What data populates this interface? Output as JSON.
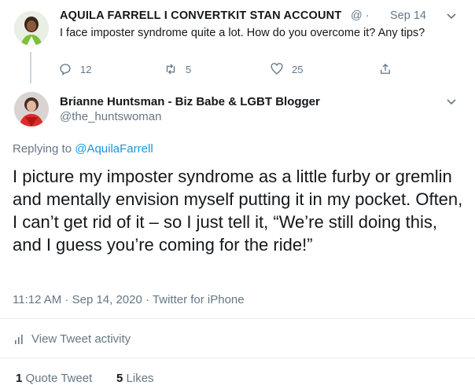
{
  "parent": {
    "name": "AQUILA FARRELL I CONVERTKIT STAN ACCOUNT",
    "handle_sep": "@ ·",
    "date": "Sep 14",
    "text": "I face imposter syndrome quite a lot. How do you overcome it? Any tips?",
    "replies": "12",
    "retweets": "5",
    "likes": "25"
  },
  "reply": {
    "name": "Brianne Huntsman - Biz Babe & LGBT Blogger",
    "handle": "@the_huntswoman",
    "replying_prefix": "Replying to",
    "replying_to": "@AquilaFarrell",
    "text": "I picture my imposter syndrome as a little furby or gremlin and mentally envision myself putting it in my pocket.  Often, I can’t get rid of it – so I just tell it, “We’re still doing this, and I guess you’re coming for the ride!”",
    "timestamp": "11:12 AM · Sep 14, 2020 · Twitter for iPhone",
    "activity": "View Tweet activity",
    "quote_count": "1",
    "quote_label": "Quote Tweet",
    "like_count": "5",
    "like_label": "Likes"
  },
  "colors": {
    "accent": "#1b95e0",
    "muted": "#657786",
    "divider": "#e6ecf0"
  }
}
